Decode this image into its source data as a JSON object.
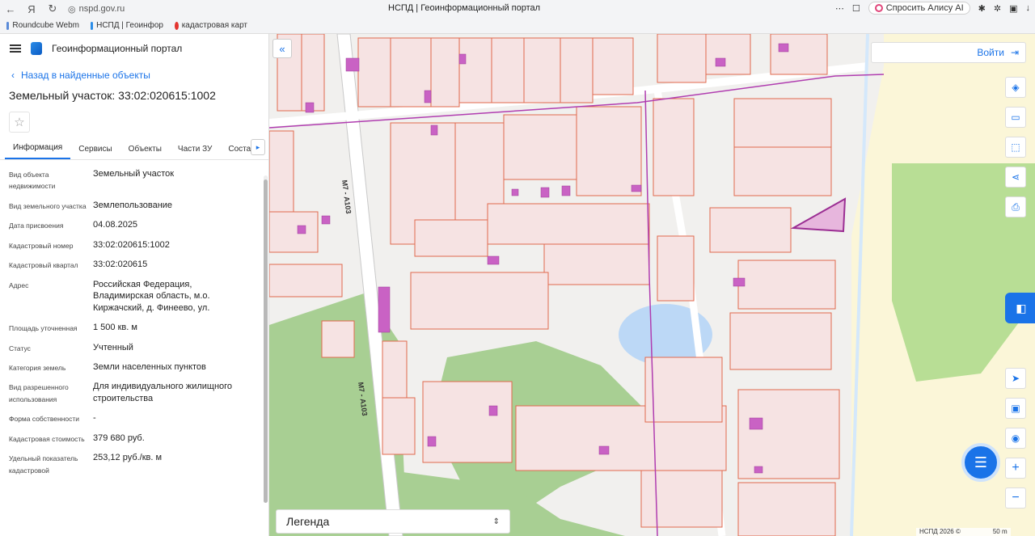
{
  "browser": {
    "url": "nspd.gov.ru",
    "window_title": "НСПД | Геоинформационный портал",
    "alisa_label": "Спросить Алису AI",
    "bookmarks": [
      "Roundcube Webm",
      "НСПД | Геоинфор",
      "кадастровая карт"
    ]
  },
  "app": {
    "title": "Геоинформационный портал",
    "back_label": "Назад в найденные объекты",
    "object_title": "Земельный участок: 33:02:020615:1002",
    "tabs": [
      "Информация",
      "Сервисы",
      "Объекты",
      "Части ЗУ",
      "Состав"
    ]
  },
  "properties": [
    {
      "label": "Вид объекта недвижимости",
      "value": "Земельный участок"
    },
    {
      "label": "Вид земельного участка",
      "value": "Землепользование"
    },
    {
      "label": "Дата присвоения",
      "value": "04.08.2025"
    },
    {
      "label": "Кадастровый номер",
      "value": "33:02:020615:1002"
    },
    {
      "label": "Кадастровый квартал",
      "value": "33:02:020615"
    },
    {
      "label": "Адрес",
      "value": "Российская Федерация, Владимирская область, м.о. Киржачский, д. Финеево, ул."
    },
    {
      "label": "Площадь уточненная",
      "value": "1 500 кв. м"
    },
    {
      "label": "Статус",
      "value": "Учтенный"
    },
    {
      "label": "Категория земель",
      "value": "Земли населенных пунктов"
    },
    {
      "label": "Вид разрешенного использования",
      "value": "Для индивидуального жилищного строительства"
    },
    {
      "label": "Форма собственности",
      "value": "-"
    },
    {
      "label": "Кадастровая стоимость",
      "value": "379 680 руб."
    },
    {
      "label": "Удельный показатель кадастровой",
      "value": "253,12 руб./кв. м"
    }
  ],
  "map": {
    "login_label": "Войти",
    "legend_label": "Легенда",
    "road_label": "М7 - А103",
    "attribution": "НСПД 2026 ©",
    "scale_label": "50 m",
    "colors": {
      "parcel_fill": "#f6e3e3",
      "parcel_stroke": "#e06a4e",
      "green": "#a8cf93",
      "water": "#bcd8f6",
      "building": "#c962c4",
      "accent": "#1a73e8"
    }
  }
}
